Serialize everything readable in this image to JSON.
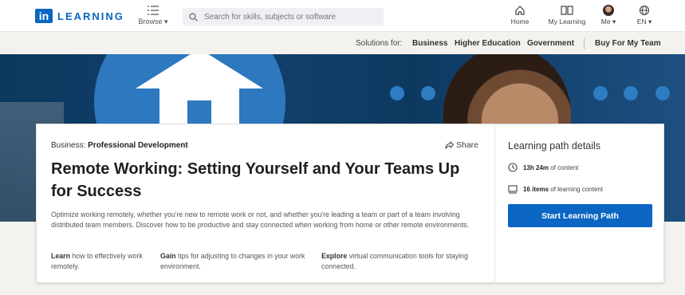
{
  "header": {
    "logo_badge": "in",
    "logo_text": "LEARNING",
    "browse_label": "Browse ▾",
    "search_placeholder": "Search for skills, subjects or software",
    "nav": {
      "home": "Home",
      "my_learning": "My Learning",
      "me": "Me ▾",
      "language": "EN ▾"
    }
  },
  "subnav": {
    "solutions_for": "Solutions for:",
    "business": "Business",
    "higher_education": "Higher Education",
    "government": "Government",
    "buy_for_team": "Buy For My Team"
  },
  "course": {
    "category_prefix": "Business: ",
    "category_name": "Professional Development",
    "share_label": "Share",
    "title": "Remote Working: Setting Yourself and Your Teams Up for Success",
    "description": "Optimize working remotely, whether you're new to remote work or not, and whether you're leading a team or part of a team involving distributed team members. Discover how to be productive and stay connected when working from home or other remote environments.",
    "features": [
      {
        "bold": "Learn",
        "text": " how to effectively work remotely."
      },
      {
        "bold": "Gain",
        "text": " tips for adjusting to changes in your work environment."
      },
      {
        "bold": "Explore",
        "text": " virtual communication tools for staying connected."
      }
    ]
  },
  "details": {
    "heading": "Learning path details",
    "duration_bold": "13h 24m",
    "duration_text": " of content",
    "items_bold": "16 items",
    "items_text": " of learning content",
    "cta_label": "Start Learning Path"
  },
  "colors": {
    "brand": "#0a66c2",
    "hero_dark": "#0d3960",
    "hero_accent": "#2d78bf"
  }
}
